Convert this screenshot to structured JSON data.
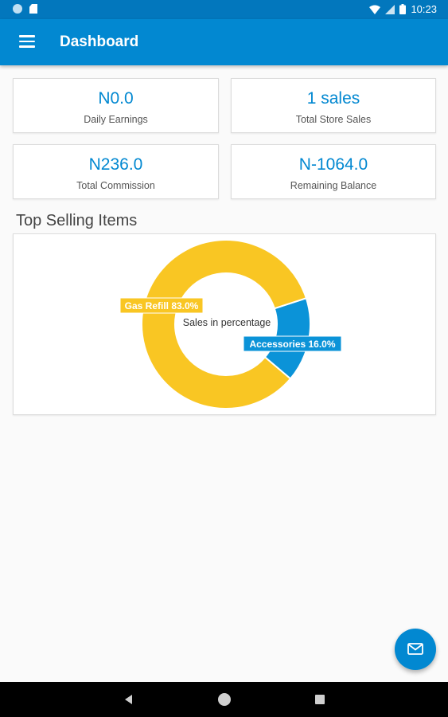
{
  "status_bar": {
    "time": "10:23",
    "icons": [
      "notification-dot-icon",
      "sd-card-icon",
      "wifi-icon",
      "signal-icon",
      "battery-icon"
    ]
  },
  "app_bar": {
    "title": "Dashboard",
    "menu_icon": "hamburger-menu-icon"
  },
  "stats": [
    {
      "value": "N0.0",
      "label": "Daily Earnings"
    },
    {
      "value": "1 sales",
      "label": "Total Store Sales"
    },
    {
      "value": "N236.0",
      "label": "Total Commission"
    },
    {
      "value": "N-1064.0",
      "label": "Remaining Balance"
    }
  ],
  "top_selling": {
    "title": "Top Selling Items"
  },
  "chart_data": {
    "type": "pie",
    "center_text": "Sales in  percentage",
    "slices": [
      {
        "label": "Gas Refill",
        "value": 83.0,
        "display": "Gas Refill 83.0%",
        "color": "#f9c623"
      },
      {
        "label": "Accessories",
        "value": 16.0,
        "display": "Accessories 16.0%",
        "color": "#0b93d8"
      }
    ],
    "legend": "none"
  },
  "fab": {
    "icon": "mail-icon"
  },
  "nav_bar": {
    "icons": [
      "back-icon",
      "home-icon",
      "recent-apps-icon"
    ]
  },
  "colors": {
    "primary": "#0288d1",
    "primary_dark": "#0277bd",
    "gas_refill": "#f9c623",
    "accessories": "#0b93d8"
  }
}
